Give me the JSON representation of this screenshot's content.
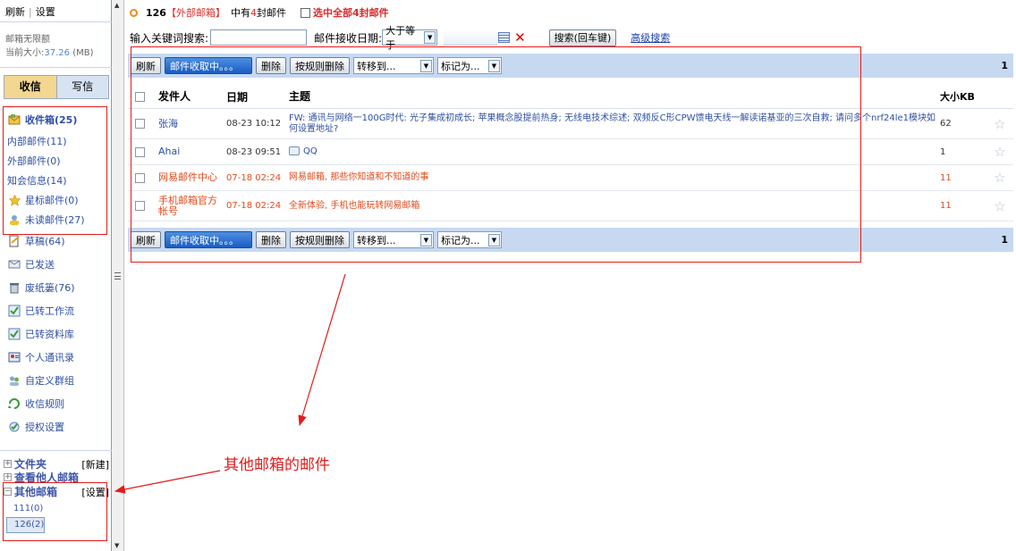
{
  "sidebar": {
    "refresh": "刷新",
    "settings": "设置",
    "quota_label": "邮箱无限额",
    "size_label": "当前大小:",
    "size_value": "37.26",
    "size_unit": "(MB)",
    "tab_receive": "收信",
    "tab_write": "写信",
    "folders": [
      {
        "label": "收件箱(25)",
        "icon": "inbox-icon",
        "bold": true
      },
      {
        "label": "内部邮件(11)",
        "icon": "",
        "bold": false
      },
      {
        "label": "外部邮件(0)",
        "icon": "",
        "bold": false
      },
      {
        "label": "知会信息(14)",
        "icon": "",
        "bold": false
      },
      {
        "label": "星标邮件(0)",
        "icon": "star-icon",
        "bold": false
      },
      {
        "label": "未读邮件(27)",
        "icon": "unread-icon",
        "bold": false
      },
      {
        "label": "草稿(64)",
        "icon": "draft-icon",
        "bold": false
      },
      {
        "label": "已发送",
        "icon": "sent-icon",
        "bold": false
      },
      {
        "label": "废纸篓(76)",
        "icon": "trash-icon",
        "bold": false
      },
      {
        "label": "已转工作流",
        "icon": "workflow-icon",
        "bold": false
      },
      {
        "label": "已转资料库",
        "icon": "library-icon",
        "bold": false
      },
      {
        "label": "个人通讯录",
        "icon": "contacts-icon",
        "bold": false
      },
      {
        "label": "自定义群组",
        "icon": "group-icon",
        "bold": false
      },
      {
        "label": "收信规则",
        "icon": "rules-icon",
        "bold": false
      },
      {
        "label": "授权设置",
        "icon": "auth-icon",
        "bold": false
      }
    ],
    "section_folders": "文件夹",
    "section_folders_action": "[新建]",
    "section_others": "查看他人邮箱",
    "section_other_boxes": "其他邮箱",
    "section_other_boxes_action": "[设置]",
    "other_boxes": [
      "111(0)",
      "126(2)"
    ]
  },
  "main": {
    "header": {
      "box_name": "126",
      "box_type": "【外部邮箱】",
      "count_prefix": "中有",
      "count": "4",
      "count_suffix": "封邮件",
      "select_all": "选中全部",
      "select_all_count": "4",
      "select_all_suffix": "封邮件"
    },
    "search": {
      "keyword_label": "输入关键词搜索:",
      "date_label": "邮件接收日期:",
      "date_op": "大于等于",
      "search_button": "搜索(回车键)",
      "advanced": "高级搜索"
    },
    "toolbar": {
      "refresh": "刷新",
      "receiving": "邮件收取中。。。",
      "delete": "删除",
      "delete_by_rule": "按规则删除",
      "move_to": "转移到...",
      "mark_as": "标记为...",
      "page": "1"
    },
    "columns": {
      "from": "发件人",
      "date": "日期",
      "subject": "主题",
      "size": "大小KB"
    },
    "emails": [
      {
        "from": "张海",
        "date": "08-23 10:12",
        "subject": "FW: 通讯与网络一100G时代: 光子集成初成长; 苹果概念股提前热身; 无线电技术综述; 双频反C形CPW馈电天线一解读诺基亚的三次自救; 请问多个nrf24le1模块如何设置地址?",
        "size": "62",
        "red": false,
        "icon": false
      },
      {
        "from": "Ahai",
        "date": "08-23 09:51",
        "subject": "QQ",
        "size": "1",
        "red": false,
        "icon": true
      },
      {
        "from": "网易邮件中心",
        "date": "07-18 02:24",
        "subject": "网易邮箱, 那些你知道和不知道的事",
        "size": "11",
        "red": true,
        "icon": false
      },
      {
        "from": "手机邮箱官方帐号",
        "date": "07-18 02:24",
        "subject": "全新体验, 手机也能玩转网易邮箱",
        "size": "11",
        "red": true,
        "icon": false
      }
    ]
  },
  "annotation": {
    "text": "其他邮箱的邮件",
    "color": "#e31b1b"
  }
}
